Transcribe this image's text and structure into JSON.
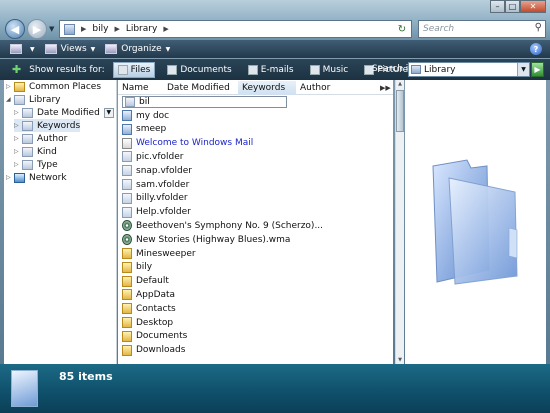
{
  "address": {
    "crumbs": [
      "bily",
      "Library"
    ]
  },
  "search_placeholder": "Search",
  "window_buttons": {
    "minimize": "–",
    "maximize": "□",
    "close": "✕"
  },
  "commandbar": {
    "views": "Views",
    "organize": "Organize"
  },
  "searchpane": {
    "show_results_for": "Show results for:",
    "filters": [
      "Files",
      "Documents",
      "E-mails",
      "Music",
      "Pictures"
    ],
    "search_in_label": "Search in:",
    "search_in_value": "Library"
  },
  "tree": [
    {
      "label": "Common Places",
      "icon": "folder-icon",
      "level": 0
    },
    {
      "label": "Library",
      "icon": "library-icon",
      "level": 0
    },
    {
      "label": "Date Modified",
      "icon": "folder-icon",
      "level": 1
    },
    {
      "label": "Keywords",
      "icon": "folder-icon",
      "level": 1,
      "selected": true
    },
    {
      "label": "Author",
      "icon": "folder-icon",
      "level": 1
    },
    {
      "label": "Kind",
      "icon": "folder-icon",
      "level": 1
    },
    {
      "label": "Type",
      "icon": "folder-icon",
      "level": 1
    },
    {
      "label": "Network",
      "icon": "network-icon",
      "level": 0
    }
  ],
  "columns": [
    "Name",
    "Date Modified",
    "Keywords",
    "Author"
  ],
  "filter_value": "bil",
  "files": [
    {
      "name": "my doc",
      "type": "search"
    },
    {
      "name": "smeep",
      "type": "search"
    },
    {
      "name": "Welcome to Windows Mail",
      "type": "mail",
      "link": true
    },
    {
      "name": "pic.vfolder",
      "type": "doc"
    },
    {
      "name": "snap.vfolder",
      "type": "doc"
    },
    {
      "name": "sam.vfolder",
      "type": "doc"
    },
    {
      "name": "billy.vfolder",
      "type": "doc"
    },
    {
      "name": "Help.vfolder",
      "type": "doc"
    },
    {
      "name": "Beethoven's Symphony No. 9 (Scherzo)...",
      "type": "music"
    },
    {
      "name": "New Stories (Highway Blues).wma",
      "type": "music"
    },
    {
      "name": "Minesweeper",
      "type": "folder"
    },
    {
      "name": "bily",
      "type": "folder"
    },
    {
      "name": "Default",
      "type": "folder"
    },
    {
      "name": "AppData",
      "type": "folder"
    },
    {
      "name": "Contacts",
      "type": "folder"
    },
    {
      "name": "Desktop",
      "type": "folder"
    },
    {
      "name": "Documents",
      "type": "folder"
    },
    {
      "name": "Downloads",
      "type": "folder"
    }
  ],
  "details": {
    "count": "85 items"
  }
}
